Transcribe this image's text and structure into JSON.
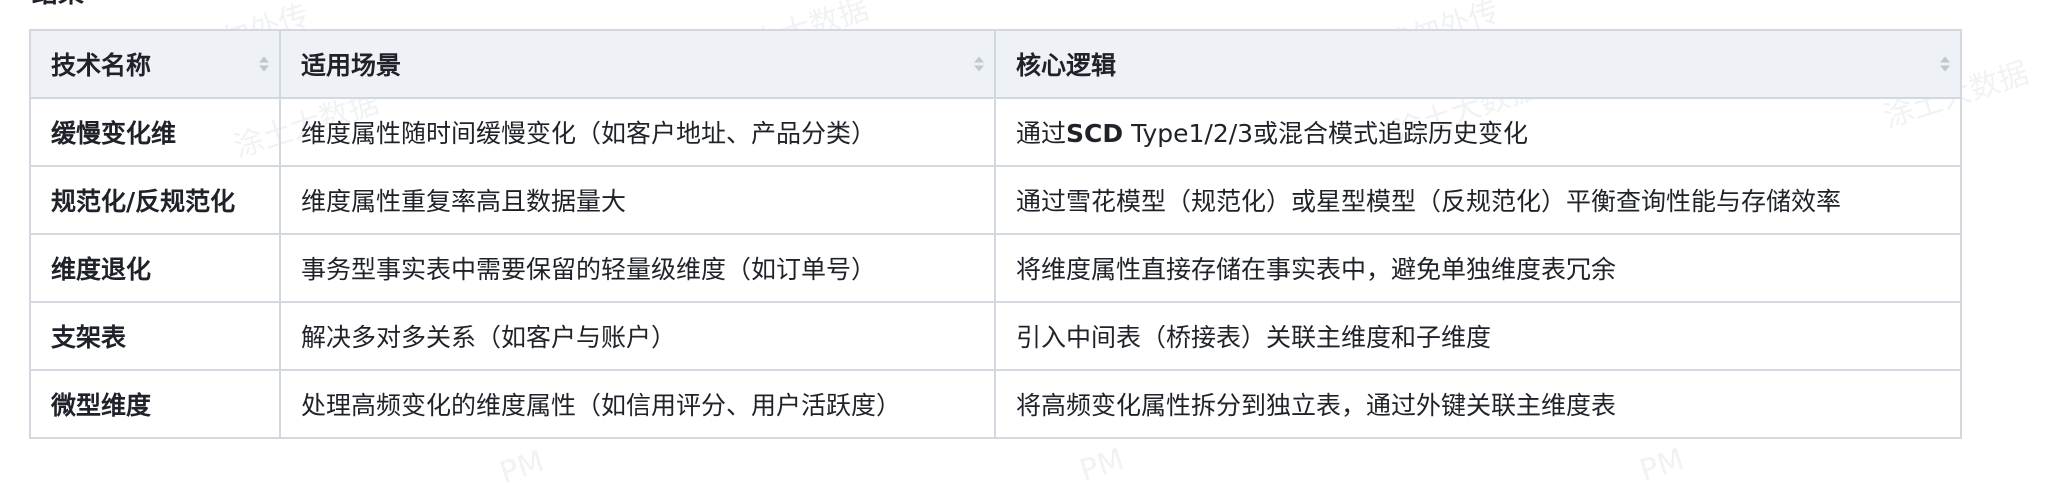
{
  "heading_fragment": "结果",
  "table": {
    "headers": [
      "技术名称",
      "适用场景",
      "核心逻辑"
    ],
    "rows": [
      {
        "name": "缓慢变化维",
        "scenario": "维度属性随时间缓慢变化（如客户地址、产品分类）",
        "logic_prefix": "通过",
        "logic_bold": "SCD",
        "logic_suffix": " Type1/2/3或混合模式追踪历史变化"
      },
      {
        "name": "规范化/反规范化",
        "scenario": "维度属性重复率高且数据量大",
        "logic": "通过雪花模型（规范化）或星型模型（反规范化）平衡查询性能与存储效率"
      },
      {
        "name": "维度退化",
        "scenario": "事务型事实表中需要保留的轻量级维度（如订单号）",
        "logic": "将维度属性直接存储在事实表中，避免单独维度表冗余"
      },
      {
        "name": "支架表",
        "scenario": "解决多对多关系（如客户与账户）",
        "logic": "引入中间表（桥接表）关联主维度和子维度"
      },
      {
        "name": "微型维度",
        "scenario": "处理高频变化的维度属性（如信用评分、用户活跃度）",
        "logic": "将高频变化属性拆分到独立表，通过外键关联主维度表"
      }
    ]
  },
  "watermark": {
    "lines": [
      "涂土大数据",
      "请勿外传",
      "PM"
    ]
  },
  "icons": {
    "sort": "sort-icon"
  },
  "colors": {
    "header_bg": "#eef1f6",
    "border": "#d3d8e0",
    "text": "#1f2329"
  }
}
